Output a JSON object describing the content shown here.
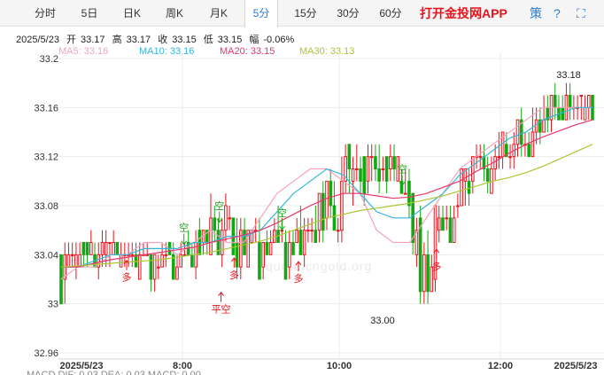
{
  "tabs": [
    {
      "label": "分时",
      "active": false
    },
    {
      "label": "5日",
      "active": false
    },
    {
      "label": "日K",
      "active": false
    },
    {
      "label": "周K",
      "active": false
    },
    {
      "label": "月K",
      "active": false
    },
    {
      "label": "5分",
      "active": true
    },
    {
      "label": "15分",
      "active": false
    },
    {
      "label": "30分",
      "active": false
    },
    {
      "label": "60分",
      "active": false
    }
  ],
  "app_link": "打开金投网APP",
  "toolbar": {
    "strategy": "策",
    "question": "?",
    "expand": "⛶"
  },
  "info": {
    "date": "2025/5/23",
    "open_label": "开",
    "open": "33.17",
    "high_label": "高",
    "high": "33.17",
    "close_label": "收",
    "close": "33.15",
    "low_label": "低",
    "low": "33.15",
    "change_label": "幅",
    "change": "-0.06%"
  },
  "ma_legend": [
    {
      "label": "MA5: 33.16",
      "color": "#f4a3be"
    },
    {
      "label": "MA10: 33.16",
      "color": "#35b4d9"
    },
    {
      "label": "MA20: 33.15",
      "color": "#e8366a"
    },
    {
      "label": "MA30: 33.13",
      "color": "#a8c732"
    }
  ],
  "watermark": "quote.cngold.org",
  "bottom_legend": "MACD  DIF: 0.03   DEA: 0.03   MACD: 0.00",
  "chart_data": {
    "type": "candlestick",
    "yticks": [
      "33.2",
      "33.16",
      "33.12",
      "33.08",
      "33.04",
      "33",
      "32.96"
    ],
    "ylim": [
      32.96,
      33.2
    ],
    "xticks": [
      "2025/5/23",
      "8:00",
      "10:00",
      "12:00",
      "2025/5/23"
    ],
    "candles": [
      [
        33.04,
        33.0,
        33.04,
        33.0
      ],
      [
        33.02,
        33.04,
        33.05,
        33.0
      ],
      [
        33.03,
        33.04,
        33.05,
        33.03
      ],
      [
        33.04,
        33.04,
        33.05,
        33.03
      ],
      [
        33.03,
        33.04,
        33.05,
        33.02
      ],
      [
        33.03,
        33.04,
        33.05,
        33.03
      ],
      [
        33.05,
        33.04,
        33.05,
        33.03
      ],
      [
        33.05,
        33.04,
        33.05,
        33.03
      ],
      [
        33.04,
        33.05,
        33.06,
        33.04
      ],
      [
        33.04,
        33.03,
        33.05,
        33.03
      ],
      [
        33.03,
        33.04,
        33.05,
        33.02
      ],
      [
        33.04,
        33.05,
        33.06,
        33.03
      ],
      [
        33.04,
        33.05,
        33.06,
        33.03
      ],
      [
        33.05,
        33.05,
        33.05,
        33.03
      ],
      [
        33.04,
        33.05,
        33.06,
        33.04
      ],
      [
        33.05,
        33.04,
        33.05,
        33.04
      ],
      [
        33.03,
        33.04,
        33.05,
        33.03
      ],
      [
        33.04,
        33.04,
        33.05,
        33.03
      ],
      [
        33.04,
        33.04,
        33.05,
        33.03
      ],
      [
        33.04,
        33.04,
        33.05,
        33.03
      ],
      [
        33.04,
        33.03,
        33.05,
        33.03
      ],
      [
        33.02,
        33.04,
        33.05,
        33.02
      ],
      [
        33.04,
        33.04,
        33.05,
        33.04
      ],
      [
        33.04,
        33.04,
        33.05,
        33.04
      ],
      [
        33.04,
        33.02,
        33.04,
        33.01
      ],
      [
        33.02,
        33.04,
        33.04,
        33.01
      ],
      [
        33.03,
        33.03,
        33.04,
        33.02
      ],
      [
        33.03,
        33.04,
        33.05,
        33.03
      ],
      [
        33.04,
        33.04,
        33.05,
        33.03
      ],
      [
        33.05,
        33.04,
        33.05,
        33.04
      ],
      [
        33.04,
        33.02,
        33.05,
        33.02
      ],
      [
        33.02,
        33.03,
        33.04,
        33.02
      ],
      [
        33.03,
        33.04,
        33.05,
        33.03
      ],
      [
        33.04,
        33.04,
        33.05,
        33.04
      ],
      [
        33.05,
        33.04,
        33.06,
        33.04
      ],
      [
        33.04,
        33.03,
        33.05,
        33.03
      ],
      [
        33.03,
        33.05,
        33.06,
        33.02
      ],
      [
        33.06,
        33.04,
        33.07,
        33.04
      ],
      [
        33.05,
        33.06,
        33.06,
        33.04
      ],
      [
        33.06,
        33.05,
        33.06,
        33.04
      ],
      [
        33.04,
        33.07,
        33.09,
        33.04
      ],
      [
        33.07,
        33.06,
        33.08,
        33.05
      ],
      [
        33.06,
        33.04,
        33.07,
        33.04
      ],
      [
        33.04,
        33.06,
        33.07,
        33.03
      ],
      [
        33.06,
        33.08,
        33.09,
        33.05
      ],
      [
        33.07,
        33.07,
        33.08,
        33.06
      ],
      [
        33.07,
        33.04,
        33.07,
        33.04
      ],
      [
        33.05,
        33.03,
        33.07,
        33.02
      ],
      [
        33.03,
        33.06,
        33.07,
        33.02
      ],
      [
        33.06,
        33.04,
        33.07,
        33.04
      ],
      [
        33.03,
        33.06,
        33.06,
        33.03
      ],
      [
        33.05,
        33.06,
        33.06,
        33.05
      ],
      [
        33.06,
        33.06,
        33.07,
        33.05
      ],
      [
        33.05,
        33.02,
        33.07,
        33.02
      ],
      [
        33.03,
        33.05,
        33.05,
        33.02
      ],
      [
        33.05,
        33.04,
        33.06,
        33.04
      ],
      [
        33.04,
        33.05,
        33.06,
        33.04
      ],
      [
        33.05,
        33.06,
        33.07,
        33.05
      ],
      [
        33.06,
        33.05,
        33.08,
        33.05
      ],
      [
        33.06,
        33.06,
        33.07,
        33.05
      ],
      [
        33.05,
        33.02,
        33.06,
        33.02
      ],
      [
        33.03,
        33.05,
        33.06,
        33.02
      ],
      [
        33.05,
        33.04,
        33.06,
        33.04
      ],
      [
        33.05,
        33.06,
        33.07,
        33.05
      ],
      [
        33.06,
        33.04,
        33.08,
        33.04
      ],
      [
        33.04,
        33.06,
        33.07,
        33.03
      ],
      [
        33.06,
        33.06,
        33.07,
        33.05
      ],
      [
        33.06,
        33.06,
        33.07,
        33.05
      ],
      [
        33.06,
        33.05,
        33.08,
        33.05
      ],
      [
        33.06,
        33.09,
        33.09,
        33.05
      ],
      [
        33.09,
        33.06,
        33.1,
        33.05
      ],
      [
        33.07,
        33.1,
        33.1,
        33.06
      ],
      [
        33.1,
        33.08,
        33.11,
        33.07
      ],
      [
        33.08,
        33.06,
        33.1,
        33.06
      ],
      [
        33.06,
        33.06,
        33.07,
        33.05
      ],
      [
        33.06,
        33.1,
        33.12,
        33.05
      ],
      [
        33.1,
        33.12,
        33.13,
        33.09
      ],
      [
        33.13,
        33.11,
        33.13,
        33.09
      ],
      [
        33.1,
        33.11,
        33.12,
        33.08
      ],
      [
        33.11,
        33.11,
        33.13,
        33.1
      ],
      [
        33.11,
        33.1,
        33.12,
        33.09
      ],
      [
        33.12,
        33.09,
        33.12,
        33.08
      ],
      [
        33.1,
        33.12,
        33.13,
        33.09
      ],
      [
        33.12,
        33.12,
        33.13,
        33.1
      ],
      [
        33.12,
        33.11,
        33.13,
        33.1
      ],
      [
        33.11,
        33.1,
        33.13,
        33.09
      ],
      [
        33.11,
        33.11,
        33.12,
        33.1
      ],
      [
        33.12,
        33.1,
        33.12,
        33.09
      ],
      [
        33.11,
        33.12,
        33.13,
        33.1
      ],
      [
        33.12,
        33.11,
        33.13,
        33.1
      ],
      [
        33.1,
        33.12,
        33.12,
        33.1
      ],
      [
        33.1,
        33.09,
        33.11,
        33.09
      ],
      [
        33.09,
        33.09,
        33.11,
        33.09
      ],
      [
        33.1,
        33.08,
        33.11,
        33.07
      ],
      [
        33.09,
        33.05,
        33.09,
        33.04
      ],
      [
        33.04,
        33.06,
        33.07,
        33.03
      ],
      [
        33.07,
        33.01,
        33.08,
        33.0
      ],
      [
        33.01,
        33.04,
        33.05,
        33.0
      ],
      [
        33.04,
        33.01,
        33.06,
        33.0
      ],
      [
        33.01,
        33.03,
        33.04,
        33.01
      ],
      [
        33.02,
        33.08,
        33.08,
        33.01
      ],
      [
        33.06,
        33.07,
        33.08,
        33.05
      ],
      [
        33.07,
        33.06,
        33.08,
        33.06
      ],
      [
        33.07,
        33.07,
        33.08,
        33.06
      ],
      [
        33.07,
        33.05,
        33.08,
        33.05
      ],
      [
        33.05,
        33.07,
        33.08,
        33.05
      ],
      [
        33.08,
        33.08,
        33.09,
        33.07
      ],
      [
        33.08,
        33.11,
        33.11,
        33.08
      ],
      [
        33.1,
        33.11,
        33.11,
        33.08
      ],
      [
        33.1,
        33.09,
        33.11,
        33.08
      ],
      [
        33.1,
        33.12,
        33.12,
        33.09
      ],
      [
        33.12,
        33.12,
        33.13,
        33.11
      ],
      [
        33.12,
        33.12,
        33.13,
        33.11
      ],
      [
        33.12,
        33.11,
        33.13,
        33.1
      ],
      [
        33.11,
        33.1,
        33.12,
        33.09
      ],
      [
        33.09,
        33.11,
        33.12,
        33.09
      ],
      [
        33.11,
        33.12,
        33.13,
        33.1
      ],
      [
        33.12,
        33.12,
        33.14,
        33.11
      ],
      [
        33.12,
        33.14,
        33.14,
        33.11
      ],
      [
        33.13,
        33.12,
        33.14,
        33.12
      ],
      [
        33.12,
        33.12,
        33.13,
        33.11
      ],
      [
        33.12,
        33.13,
        33.14,
        33.11
      ],
      [
        33.13,
        33.15,
        33.15,
        33.12
      ],
      [
        33.15,
        33.13,
        33.16,
        33.12
      ],
      [
        33.13,
        33.13,
        33.14,
        33.12
      ],
      [
        33.13,
        33.12,
        33.14,
        33.12
      ],
      [
        33.12,
        33.14,
        33.16,
        33.12
      ],
      [
        33.14,
        33.15,
        33.16,
        33.13
      ],
      [
        33.15,
        33.14,
        33.16,
        33.13
      ],
      [
        33.14,
        33.15,
        33.17,
        33.14
      ],
      [
        33.16,
        33.15,
        33.17,
        33.14
      ],
      [
        33.15,
        33.17,
        33.17,
        33.14
      ],
      [
        33.17,
        33.16,
        33.18,
        33.15
      ],
      [
        33.16,
        33.15,
        33.17,
        33.15
      ],
      [
        33.16,
        33.15,
        33.17,
        33.15
      ],
      [
        33.15,
        33.17,
        33.18,
        33.15
      ],
      [
        33.17,
        33.16,
        33.18,
        33.15
      ],
      [
        33.16,
        33.16,
        33.17,
        33.15
      ],
      [
        33.16,
        33.16,
        33.17,
        33.15
      ],
      [
        33.17,
        33.17,
        33.17,
        33.15
      ],
      [
        33.15,
        33.16,
        33.17,
        33.15
      ],
      [
        33.16,
        33.17,
        33.17,
        33.15
      ],
      [
        33.17,
        33.15,
        33.17,
        33.15
      ]
    ],
    "ma_series": [
      {
        "name": "MA5",
        "color": "#f4a3be",
        "values": [
          33.02,
          33.03,
          33.03,
          33.04,
          33.04,
          33.05,
          33.05,
          33.04,
          33.05,
          33.06,
          33.05,
          33.05,
          33.07,
          33.09,
          33.1,
          33.11,
          33.11,
          33.1,
          33.09,
          33.06,
          33.05,
          33.05,
          33.07,
          33.09,
          33.11,
          33.12,
          33.13,
          33.14,
          33.15,
          33.16,
          33.16,
          33.16,
          33.16
        ]
      },
      {
        "name": "MA10",
        "color": "#35b4d9",
        "values": [
          33.03,
          33.03,
          33.035,
          33.04,
          33.04,
          33.045,
          33.045,
          33.045,
          33.05,
          33.05,
          33.055,
          33.055,
          33.06,
          33.075,
          33.09,
          33.1,
          33.11,
          33.105,
          33.09,
          33.075,
          33.07,
          33.07,
          33.08,
          33.09,
          33.105,
          33.115,
          33.125,
          33.135,
          33.14,
          33.15,
          33.155,
          33.16,
          33.16
        ]
      },
      {
        "name": "MA20",
        "color": "#e8366a",
        "values": [
          33.03,
          33.03,
          33.033,
          33.036,
          33.038,
          33.04,
          33.042,
          33.044,
          33.046,
          33.05,
          33.053,
          33.056,
          33.06,
          33.066,
          33.073,
          33.08,
          33.086,
          33.09,
          33.09,
          33.088,
          33.086,
          33.087,
          33.09,
          33.095,
          33.1,
          33.108,
          33.115,
          33.123,
          33.13,
          33.136,
          33.141,
          33.146,
          33.15
        ]
      },
      {
        "name": "MA30",
        "color": "#a8c732",
        "values": [
          33.03,
          33.031,
          33.032,
          33.033,
          33.034,
          33.035,
          33.036,
          33.038,
          33.04,
          33.042,
          33.045,
          33.048,
          33.051,
          33.055,
          33.06,
          33.065,
          33.07,
          33.073,
          33.076,
          33.078,
          33.08,
          33.082,
          33.085,
          33.088,
          33.092,
          33.096,
          33.1,
          33.103,
          33.107,
          33.112,
          33.118,
          33.124,
          33.13
        ]
      }
    ],
    "annotations": [
      {
        "text": "33.18",
        "kind": "high"
      },
      {
        "text": "33.00",
        "kind": "low"
      },
      {
        "text": "多",
        "kind": "buy",
        "pos": [
          0.125,
          33.026
        ]
      },
      {
        "text": "空",
        "kind": "sell",
        "pos": [
          0.23,
          33.052
        ]
      },
      {
        "text": "空",
        "kind": "sell",
        "pos": [
          0.295,
          33.07
        ]
      },
      {
        "text": "平空",
        "kind": "close",
        "pos": [
          0.298,
          33.0
        ]
      },
      {
        "text": "多",
        "kind": "buy",
        "pos": [
          0.322,
          33.028
        ]
      },
      {
        "text": "空",
        "kind": "sell",
        "pos": [
          0.41,
          33.064
        ]
      },
      {
        "text": "多",
        "kind": "buy",
        "pos": [
          0.44,
          33.025
        ]
      },
      {
        "text": "空",
        "kind": "sell",
        "pos": [
          0.63,
          33.1
        ]
      },
      {
        "text": "多",
        "kind": "buy",
        "pos": [
          0.693,
          33.035
        ]
      }
    ]
  }
}
